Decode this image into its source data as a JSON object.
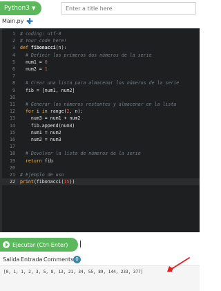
{
  "header": {
    "language": "Python3",
    "title_placeholder": "Enter a title here"
  },
  "file_tab": {
    "name": "Main.py"
  },
  "editor": {
    "lines": [
      {
        "n": "1",
        "html": "<span class=\"cm\"># coding: utf-8</span>"
      },
      {
        "n": "2",
        "html": "<span class=\"cm\"># Your code here!</span>"
      },
      {
        "n": "3",
        "html": "<span class=\"kw\">def</span> <span class=\"fn\">fibonacci</span>(n):"
      },
      {
        "n": "4",
        "html": "  <span class=\"cm\"># Definir los primeros dos números de la serie</span>"
      },
      {
        "n": "5",
        "html": "  num1 = <span class=\"num\">0</span>"
      },
      {
        "n": "6",
        "html": "  num2 = <span class=\"num\">1</span>"
      },
      {
        "n": "7",
        "html": ""
      },
      {
        "n": "8",
        "html": "  <span class=\"cm\"># Crear una lista para almacenar los números de la serie</span>"
      },
      {
        "n": "9",
        "html": "  fib = [num1, num2]"
      },
      {
        "n": "10",
        "html": ""
      },
      {
        "n": "11",
        "html": "  <span class=\"cm\"># Generar los números restantes y almacenar en la lista</span>"
      },
      {
        "n": "12",
        "html": "  <span class=\"kw\">for</span> i <span class=\"kw\">in</span> range(<span class=\"num\">2</span>, n):"
      },
      {
        "n": "13",
        "html": "    num3 = num1 + num2"
      },
      {
        "n": "14",
        "html": "    fib.append(num3)"
      },
      {
        "n": "15",
        "html": "    num1 = num2"
      },
      {
        "n": "16",
        "html": "    num2 = num3"
      },
      {
        "n": "17",
        "html": ""
      },
      {
        "n": "18",
        "html": "  <span class=\"cm\"># Devolver la lista de números de la serie</span>"
      },
      {
        "n": "19",
        "html": "  <span class=\"kw\">return</span> fib"
      },
      {
        "n": "20",
        "html": ""
      },
      {
        "n": "21",
        "html": "<span class=\"cm\"># Ejemplo de uso</span>"
      },
      {
        "n": "22",
        "html": "<span class=\"kw\">print</span>(fibonacci(<span class=\"num\">15</span>))"
      }
    ],
    "active_line": "22"
  },
  "run": {
    "label": "Ejecutar (Ctrl-Enter)"
  },
  "output_tabs": {
    "salida": "Salida",
    "entrada": "Entrada",
    "comments": "Comments",
    "comments_count": "0"
  },
  "output": {
    "text": "[0, 1, 1, 2, 3, 5, 8, 13, 21, 34, 55, 89, 144, 233, 377]"
  },
  "colors": {
    "accent_green": "#5cb85c",
    "editor_bg": "#1d1f21",
    "annotation_red": "#e02020"
  }
}
